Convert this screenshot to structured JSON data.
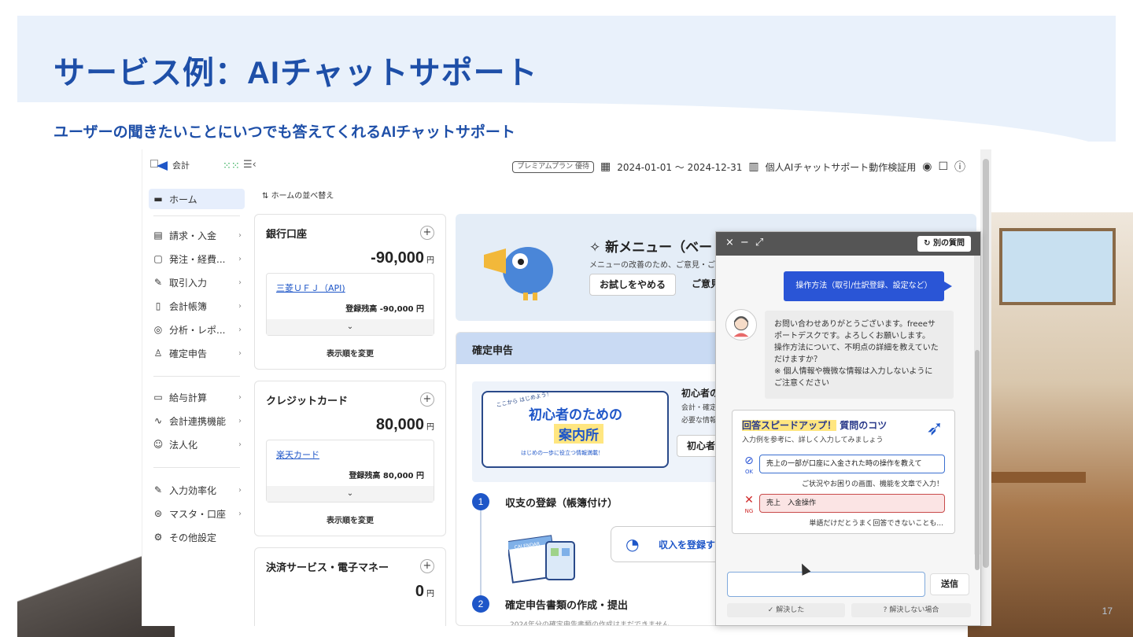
{
  "slide": {
    "title": "サービス例：AIチャットサポート",
    "subtitle": "ユーザーの聞きたいことにいつでも答えてくれるAIチャットサポート",
    "page_number": "17"
  },
  "header": {
    "logo_text": "会計",
    "plan_badge": "プレミアムプラン 優待",
    "period": "2024-01-01 ～ 2024-12-31",
    "company": "個人AIチャットサポート動作検証用"
  },
  "sidebar": {
    "home": "ホーム",
    "items": [
      {
        "label": "請求・入金",
        "icon": "document-icon"
      },
      {
        "label": "発注・経費...",
        "icon": "receipt-icon"
      },
      {
        "label": "取引入力",
        "icon": "pen-icon"
      },
      {
        "label": "会計帳簿",
        "icon": "book-icon"
      },
      {
        "label": "分析・レポ...",
        "icon": "analysis-icon"
      },
      {
        "label": "確定申告",
        "icon": "tax-icon"
      },
      {
        "label": "給与計算",
        "icon": "payroll-icon"
      },
      {
        "label": "会計連携機能",
        "icon": "link-icon"
      },
      {
        "label": "法人化",
        "icon": "corporate-icon"
      },
      {
        "label": "入力効率化",
        "icon": "efficiency-icon"
      },
      {
        "label": "マスタ・口座",
        "icon": "database-icon"
      },
      {
        "label": "その他設定",
        "icon": "settings-icon"
      }
    ]
  },
  "main": {
    "sort_label": "ホームの並べ替え",
    "bank": {
      "title": "銀行口座",
      "amount": "-90,000",
      "currency": "円",
      "account_name": "三菱ＵＦＪ（API)",
      "balance_label": "登録残高 -90,000 円",
      "sort_link": "表示順を変更"
    },
    "credit": {
      "title": "クレジットカード",
      "amount": "80,000",
      "currency": "円",
      "account_name": "楽天カード",
      "balance_label": "登録残高 80,000 円",
      "sort_link": "表示順を変更"
    },
    "payment": {
      "title": "決済サービス・電子マネー",
      "amount": "0",
      "currency": "円"
    },
    "banner": {
      "title": "新メニュー（ベー",
      "text": "メニューの改善のため、ご意見・ご",
      "stop_button": "お試しをやめる",
      "feedback_button": "ご意見"
    },
    "tax": {
      "header": "確定申告",
      "guide_kicker": "ここから はじめよう！",
      "guide_title_1": "初心者のための",
      "guide_title_2": "案内所",
      "guide_foot": "はじめの一歩に役立つ情報満載！",
      "guide_side_title": "初心者のた",
      "guide_side_text_1": "会計・確定",
      "guide_side_text_2": "必要な情報",
      "guide_side_button": "初心者の",
      "step1_num": "1",
      "step1_title": "収支の登録（帳簿付け）",
      "register_button": "収入を登録す",
      "calendar_label": "CALENDAR",
      "step2_num": "2",
      "step2_title": "確定申告書類の作成・提出",
      "step2_note": "2024年分の確定申告書類の作成はまだできません"
    }
  },
  "chat": {
    "other_question": "別の質問",
    "user_message": "操作方法（取引/仕訳登録、設定など）",
    "bot_lines": [
      "お問い合わせありがとうございます。freeeサ",
      "ポートデスクです。よろしくお願いします。",
      "操作方法について、不明点の詳細を教えていた",
      "だけますか？",
      "※ 個人情報や機微な情報は入力しないように",
      "ご注意ください"
    ],
    "tips": {
      "title_highlight": "回答スピードアップ！",
      "title_rest": "質問のコツ",
      "subtitle": "入力例を参考に、詳しく入力してみましょう",
      "ok_label": "OK",
      "ok_example": "売上の一部が口座に入金された時の操作を教えて",
      "ok_note": "ご状況やお困りの画面、機能を文章で入力！",
      "ng_label": "NG",
      "ng_example": "売上　入金操作",
      "ng_note": "単語だけだとうまく回答できないことも..."
    },
    "input_value": "",
    "send_button": "送信",
    "resolved_button": "解決した",
    "unresolved_button": "解決しない場合"
  }
}
